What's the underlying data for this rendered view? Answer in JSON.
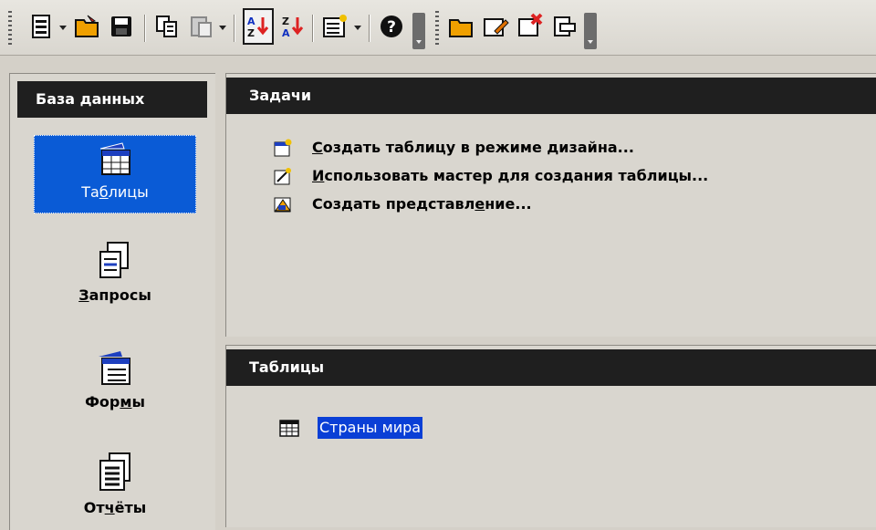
{
  "toolbar": {
    "icons": [
      "new-document-icon",
      "open-folder-icon",
      "save-icon",
      "copy-icon",
      "paste-icon",
      "sort-ascending-icon",
      "sort-descending-icon",
      "form-design-icon",
      "help-icon",
      "open-database-object-icon",
      "edit-icon",
      "delete-icon",
      "rename-icon"
    ]
  },
  "sidebar": {
    "header": "База данных",
    "items": [
      {
        "label": "Таблицы",
        "accel": "б"
      },
      {
        "label": "Запросы",
        "accel": "З"
      },
      {
        "label": "Формы",
        "accel": "м"
      },
      {
        "label": "Отчёты",
        "accel": "ч"
      }
    ]
  },
  "tasks": {
    "header": "Задачи",
    "items": [
      "Создать таблицу в режиме дизайна...",
      "Использовать мастер для создания таблицы...",
      "Создать представление..."
    ]
  },
  "tables": {
    "header": "Таблицы",
    "items": [
      "Страны мира"
    ]
  },
  "colors": {
    "header_bg": "#1f1f1f",
    "selection": "#0a5bd6",
    "panel_bg": "#d9d6cf"
  }
}
